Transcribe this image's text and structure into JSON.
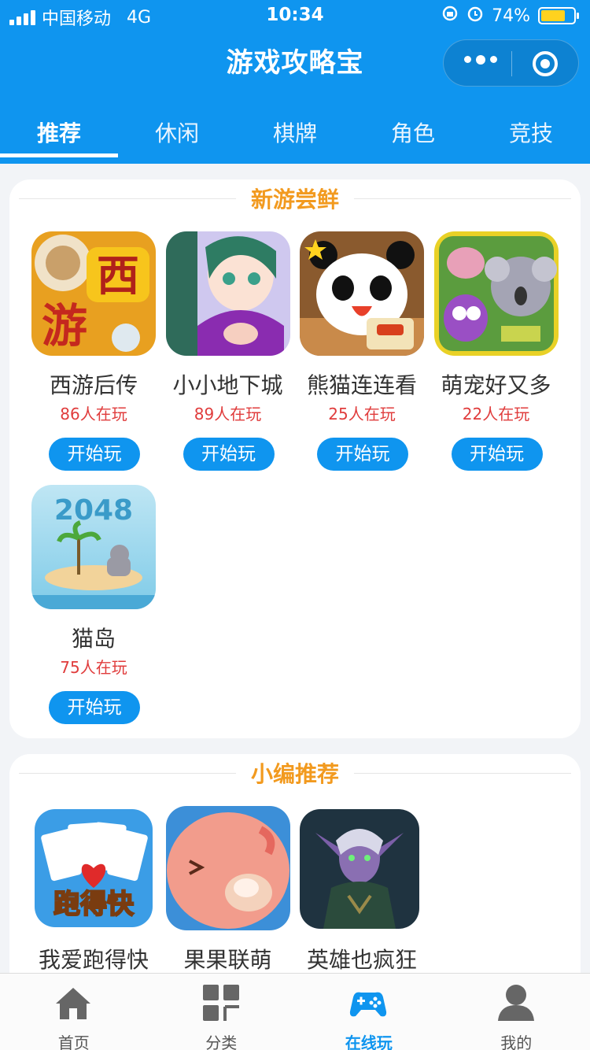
{
  "status_bar": {
    "carrier": "中国移动",
    "network": "4G",
    "time": "10:34",
    "battery": "74%",
    "battery_level": 0.74
  },
  "header": {
    "title": "游戏攻略宝",
    "brand_color": "#0f95ef"
  },
  "tabs": [
    {
      "label": "推荐",
      "active": true
    },
    {
      "label": "休闲"
    },
    {
      "label": "棋牌"
    },
    {
      "label": "角色"
    },
    {
      "label": "竞技"
    }
  ],
  "section_new": {
    "title": "新游尝鲜",
    "games": [
      {
        "name": "西游后传",
        "online": "86人在玩",
        "button": "开始玩",
        "icon": "xiyou-game-icon"
      },
      {
        "name": "小小地下城",
        "online": "89人在玩",
        "button": "开始玩",
        "icon": "anime-girl-game-icon"
      },
      {
        "name": "熊猫连连看",
        "online": "25人在玩",
        "button": "开始玩",
        "icon": "panda-game-icon"
      },
      {
        "name": "萌宠好又多",
        "online": "22人在玩",
        "button": "开始玩",
        "icon": "koala-game-icon"
      },
      {
        "name": "猫岛",
        "online": "75人在玩",
        "button": "开始玩",
        "icon": "cat-island-2048-icon",
        "icon_text": "2048"
      }
    ]
  },
  "section_editor": {
    "title": "小编推荐",
    "games": [
      {
        "name": "我爱跑得快",
        "icon": "poker-cards-game-icon",
        "icon_text": "跑得快"
      },
      {
        "name": "果果联萌",
        "icon": "pink-blob-game-icon"
      },
      {
        "name": "英雄也疯狂",
        "icon": "night-elf-hero-icon"
      }
    ]
  },
  "bottom_nav": [
    {
      "label": "首页",
      "icon": "home-icon"
    },
    {
      "label": "分类",
      "icon": "category-grid-icon"
    },
    {
      "label": "在线玩",
      "icon": "gamepad-icon",
      "active": true
    },
    {
      "label": "我的",
      "icon": "user-icon"
    }
  ]
}
